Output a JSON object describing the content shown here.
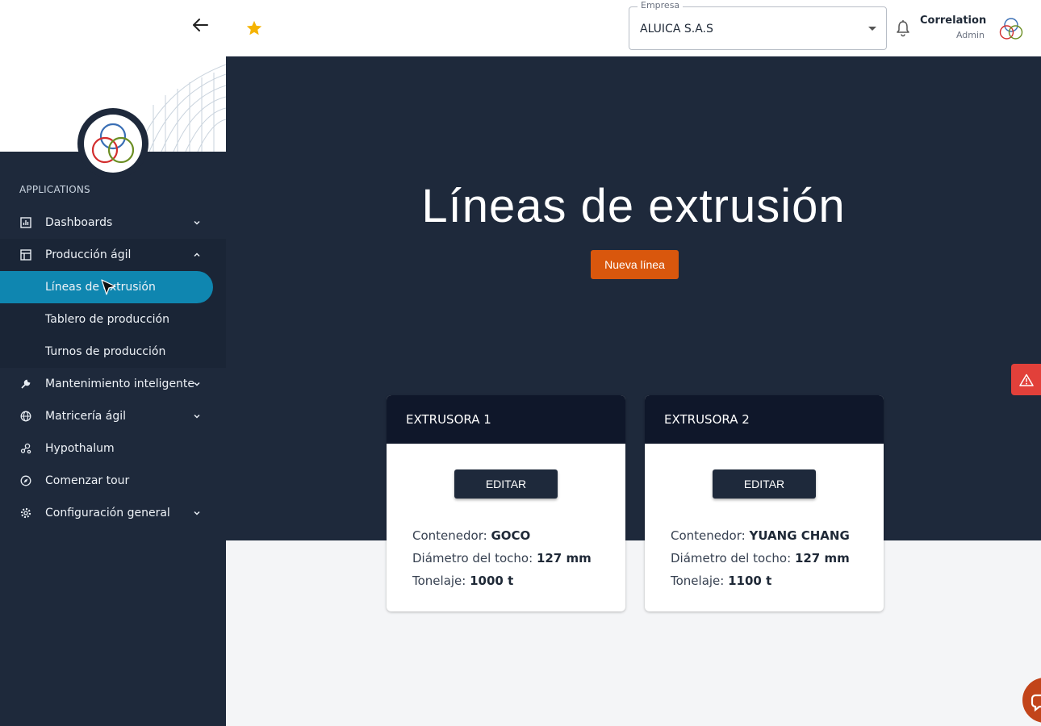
{
  "sidebar": {
    "section_label": "APPLICATIONS",
    "items": [
      {
        "label": "Dashboards",
        "icon": "bar-chart-icon",
        "expandable": true
      },
      {
        "label": "Producción ágil",
        "icon": "factory-icon",
        "expandable": true,
        "expanded": true
      },
      {
        "label": "Mantenimiento inteligente",
        "icon": "wrench-icon",
        "expandable": true
      },
      {
        "label": "Matricería ágil",
        "icon": "globe-icon",
        "expandable": true
      },
      {
        "label": "Hypothalum",
        "icon": "nodes-icon",
        "expandable": false
      },
      {
        "label": "Comenzar tour",
        "icon": "compass-icon",
        "expandable": false
      },
      {
        "label": "Configuración general",
        "icon": "gear-icon",
        "expandable": true
      }
    ],
    "sub_items": [
      {
        "label": "Líneas de extrusión",
        "active": true
      },
      {
        "label": "Tablero de producción",
        "active": false
      },
      {
        "label": "Turnos de producción",
        "active": false
      }
    ]
  },
  "topbar": {
    "company_legend": "Empresa",
    "company_value": "ALUICA S.A.S",
    "user_name": "Correlation",
    "user_role": "Admin"
  },
  "main": {
    "title": "Líneas de extrusión",
    "new_button": "Nueva línea",
    "cards": [
      {
        "title": "EXTRUSORA 1",
        "edit_label": "EDITAR",
        "container_label": "Contenedor:",
        "container_value": "GOCO",
        "diameter_label": "Diámetro del tocho:",
        "diameter_value": "127 mm",
        "tonnage_label": "Tonelaje:",
        "tonnage_value": "1000 t"
      },
      {
        "title": "EXTRUSORA 2",
        "edit_label": "EDITAR",
        "container_label": "Contenedor:",
        "container_value": "YUANG CHANG",
        "diameter_label": "Diámetro del tocho:",
        "diameter_value": "127 mm",
        "tonnage_label": "Tonelaje:",
        "tonnage_value": "1100 t"
      }
    ]
  },
  "colors": {
    "sidebar_bg": "#1e293b",
    "active_item": "#0f86b0",
    "accent_orange": "#d9570d",
    "card_header": "#0f172a",
    "alert_red": "#e2403a",
    "star_yellow": "#f5b301"
  }
}
